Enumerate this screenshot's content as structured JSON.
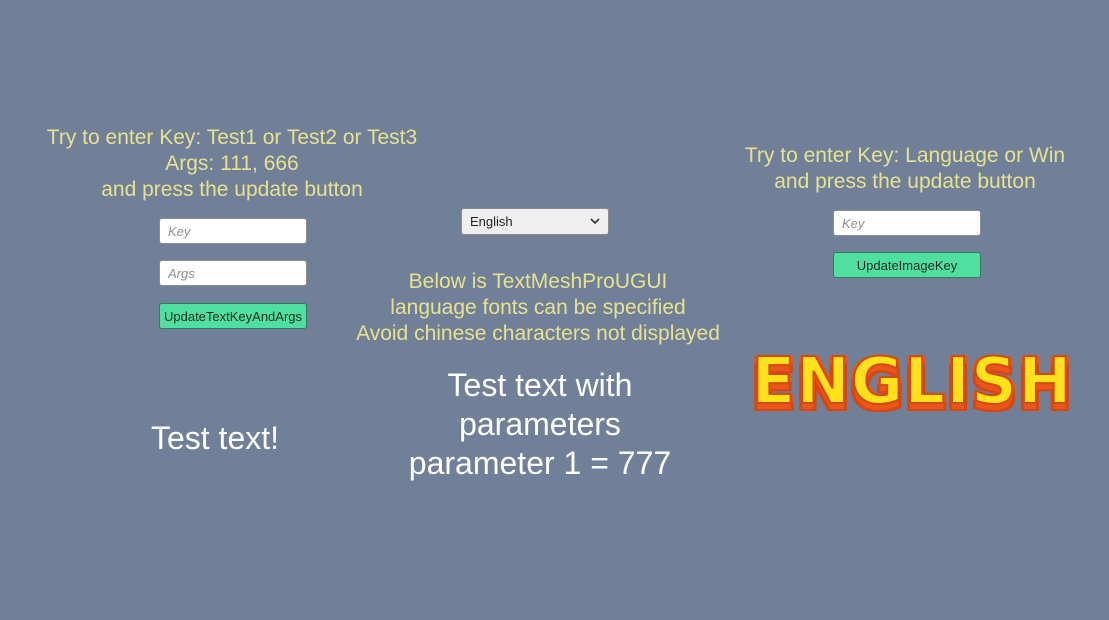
{
  "left_panel": {
    "instructions": [
      "Try to enter Key: Test1 or Test2 or Test3",
      "Args: 111, 666",
      "and press the update button"
    ],
    "key_placeholder": "Key",
    "args_placeholder": "Args",
    "update_button_label": "UpdateTextKeyAndArgs",
    "test_text": "Test text!"
  },
  "center_panel": {
    "language_selected": "English",
    "info_lines": [
      "Below is TextMeshProUGUI",
      "language fonts can be specified",
      "Avoid chinese characters not displayed"
    ],
    "tmp_text_lines": [
      "Test text with",
      "parameters",
      "parameter 1 = 777"
    ]
  },
  "right_panel": {
    "instructions": [
      "Try to enter Key: Language or Win",
      "and press the update button"
    ],
    "key_placeholder": "Key",
    "update_button_label": "UpdateImageKey",
    "logo_text": "ENGLISH"
  },
  "colors": {
    "background": "#6f8098",
    "instruction_text": "#e8e28e",
    "button": "#4fe0a0",
    "logo_fill": "#ffe21a",
    "logo_outline": "#d9460f"
  },
  "icons": {
    "dropdown_arrow": "chevron-down-icon"
  }
}
